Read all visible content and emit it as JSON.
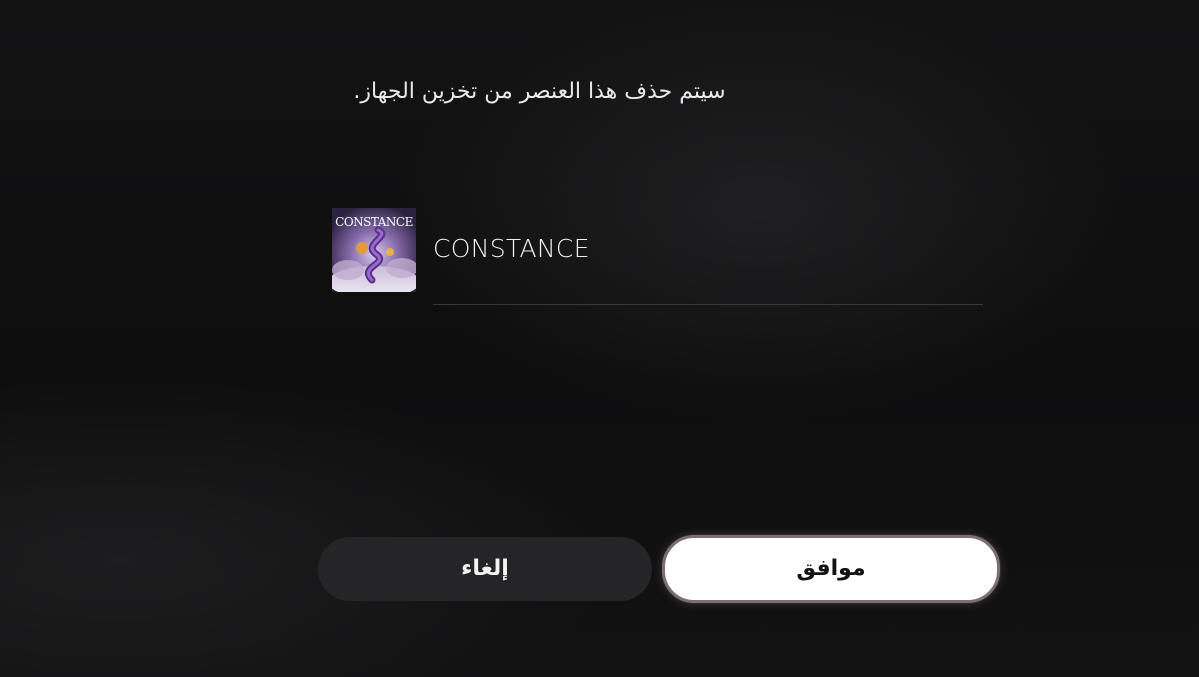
{
  "dialog": {
    "message": "سيتم حذف هذا العنصر من تخزين الجهاز."
  },
  "item": {
    "title": "CONSTANCE",
    "thumbnail_text": "CONSTANCE"
  },
  "buttons": {
    "cancel_label": "إلغاء",
    "ok_label": "موافق"
  },
  "colors": {
    "background": "#0d0d0e",
    "ok_button": "#ffffff",
    "cancel_button": "#252527",
    "focus_ring": "#7b6f70"
  }
}
